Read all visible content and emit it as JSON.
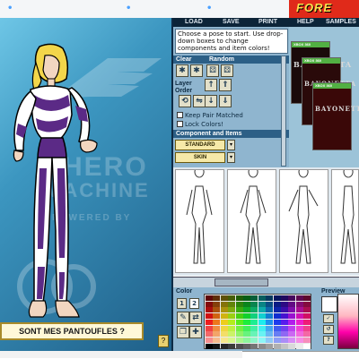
{
  "app": {
    "logo_text": "FORE"
  },
  "menu": {
    "items": [
      "LOAD",
      "SAVE",
      "PRINT",
      "HELP",
      "SAMPLES"
    ]
  },
  "instructions": "Choose a pose to start. Use drop-down boxes to change components and item colors!",
  "tools": {
    "section_clear_label": "Clear",
    "section_random_label": "Random",
    "layer_label": "Layer Order",
    "keep_pair_label": "Keep Pair Matched",
    "lock_colors_label": "Lock Colors!",
    "component_section_label": "Component and Items",
    "dropdown_1_value": "STANDARD",
    "dropdown_2_value": "SKIN"
  },
  "preview": {
    "cover_brand": "XBOX 360",
    "cover_title": "BAYONETTA"
  },
  "stage": {
    "watermark_line1": "HERO",
    "watermark_line2": "MACHINE",
    "watermark_line3": "POWERED BY",
    "speech_text": "SONT MES PANTOUFLES ?"
  },
  "colors": {
    "panel_label": "Color",
    "preview_label": "Preview",
    "tab_1": "1",
    "tab_2": "2",
    "accent_dark": "#0c2438",
    "panel_blue": "#8fb5cf",
    "costume_purple": "#5b2a86"
  }
}
